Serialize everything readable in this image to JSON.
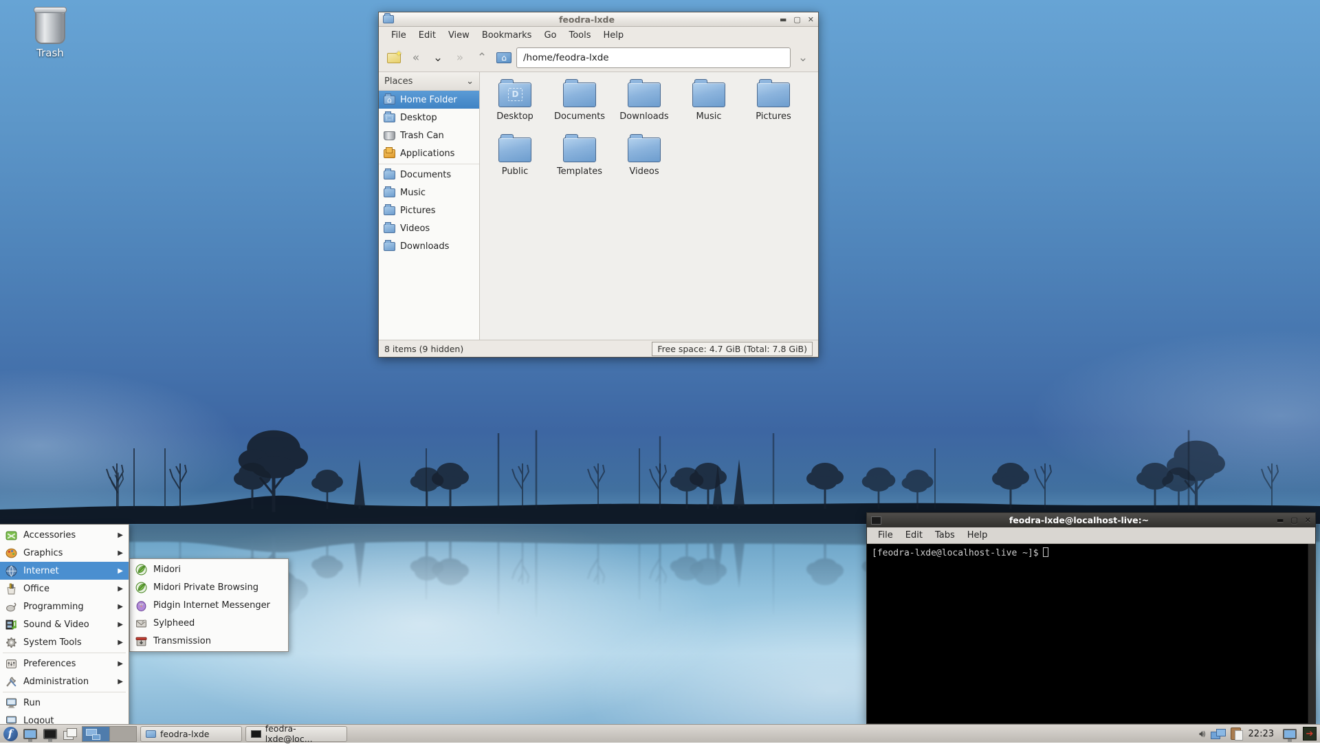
{
  "desktop": {
    "trash_label": "Trash"
  },
  "file_manager": {
    "title": "feodra-lxde",
    "menubar": [
      "File",
      "Edit",
      "View",
      "Bookmarks",
      "Go",
      "Tools",
      "Help"
    ],
    "address": "/home/feodra-lxde",
    "sidebar": {
      "header": "Places",
      "items": [
        {
          "label": "Home Folder",
          "icon": "home-folder"
        },
        {
          "label": "Desktop",
          "icon": "desktop-folder"
        },
        {
          "label": "Trash Can",
          "icon": "trash"
        },
        {
          "label": "Applications",
          "icon": "applications"
        },
        {
          "label": "Documents",
          "icon": "folder"
        },
        {
          "label": "Music",
          "icon": "folder"
        },
        {
          "label": "Pictures",
          "icon": "folder"
        },
        {
          "label": "Videos",
          "icon": "folder"
        },
        {
          "label": "Downloads",
          "icon": "folder"
        }
      ]
    },
    "files": [
      {
        "name": "Desktop"
      },
      {
        "name": "Documents"
      },
      {
        "name": "Downloads"
      },
      {
        "name": "Music"
      },
      {
        "name": "Pictures"
      },
      {
        "name": "Public"
      },
      {
        "name": "Templates"
      },
      {
        "name": "Videos"
      }
    ],
    "status_left": "8 items (9 hidden)",
    "status_right": "Free space: 4.7 GiB (Total: 7.8 GiB)"
  },
  "terminal": {
    "title": "feodra-lxde@localhost-live:~",
    "menubar": [
      "File",
      "Edit",
      "Tabs",
      "Help"
    ],
    "prompt": "[feodra-lxde@localhost-live ~]$"
  },
  "app_menu": {
    "items": [
      {
        "label": "Accessories"
      },
      {
        "label": "Graphics"
      },
      {
        "label": "Internet"
      },
      {
        "label": "Office"
      },
      {
        "label": "Programming"
      },
      {
        "label": "Sound & Video"
      },
      {
        "label": "System Tools"
      },
      {
        "label": "Preferences"
      },
      {
        "label": "Administration"
      },
      {
        "label": "Run"
      },
      {
        "label": "Logout"
      }
    ],
    "submenu": [
      {
        "label": "Midori"
      },
      {
        "label": "Midori Private Browsing"
      },
      {
        "label": "Pidgin Internet Messenger"
      },
      {
        "label": "Sylpheed"
      },
      {
        "label": "Transmission"
      }
    ]
  },
  "taskbar": {
    "tasks": [
      {
        "label": "feodra-lxde"
      },
      {
        "label": "feodra-lxde@loc..."
      }
    ],
    "clock": "22:23"
  },
  "colors": {
    "selection_blue": "#4a8fd0",
    "sky_top": "#67a4d5",
    "sky_deep": "#3d66a2",
    "tree_silhouette": "#16202e"
  }
}
